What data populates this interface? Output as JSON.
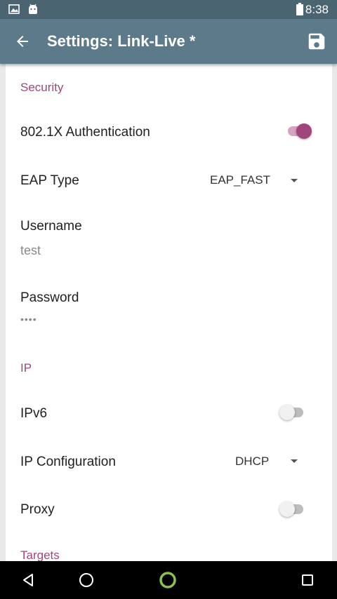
{
  "status_bar": {
    "time": "8:38",
    "icons": [
      "image-notification-icon",
      "android-notification-icon",
      "battery-icon"
    ]
  },
  "app_bar": {
    "title": "Settings: Link-Live *",
    "back_icon": "arrow-back-icon",
    "save_icon": "save-icon"
  },
  "sections": {
    "security": {
      "header": "Security",
      "auth": {
        "label": "802.1X Authentication",
        "enabled": true
      },
      "eap_type": {
        "label": "EAP Type",
        "value": "EAP_FAST"
      },
      "username": {
        "label": "Username",
        "value": "test"
      },
      "password": {
        "label": "Password",
        "value": "••••"
      }
    },
    "ip": {
      "header": "IP",
      "ipv6": {
        "label": "IPv6",
        "enabled": false
      },
      "ip_config": {
        "label": "IP Configuration",
        "value": "DHCP"
      },
      "proxy": {
        "label": "Proxy",
        "enabled": false
      }
    },
    "targets": {
      "header": "Targets"
    }
  },
  "colors": {
    "status_bar": "#4b6472",
    "app_bar": "#5c7a89",
    "accent": "#a0467c",
    "nav_accent": "#8bc34a"
  },
  "nav_bar": {
    "icons": [
      "back-triangle-icon",
      "home-circle-icon",
      "assistant-ring-icon",
      "recents-square-icon"
    ]
  }
}
